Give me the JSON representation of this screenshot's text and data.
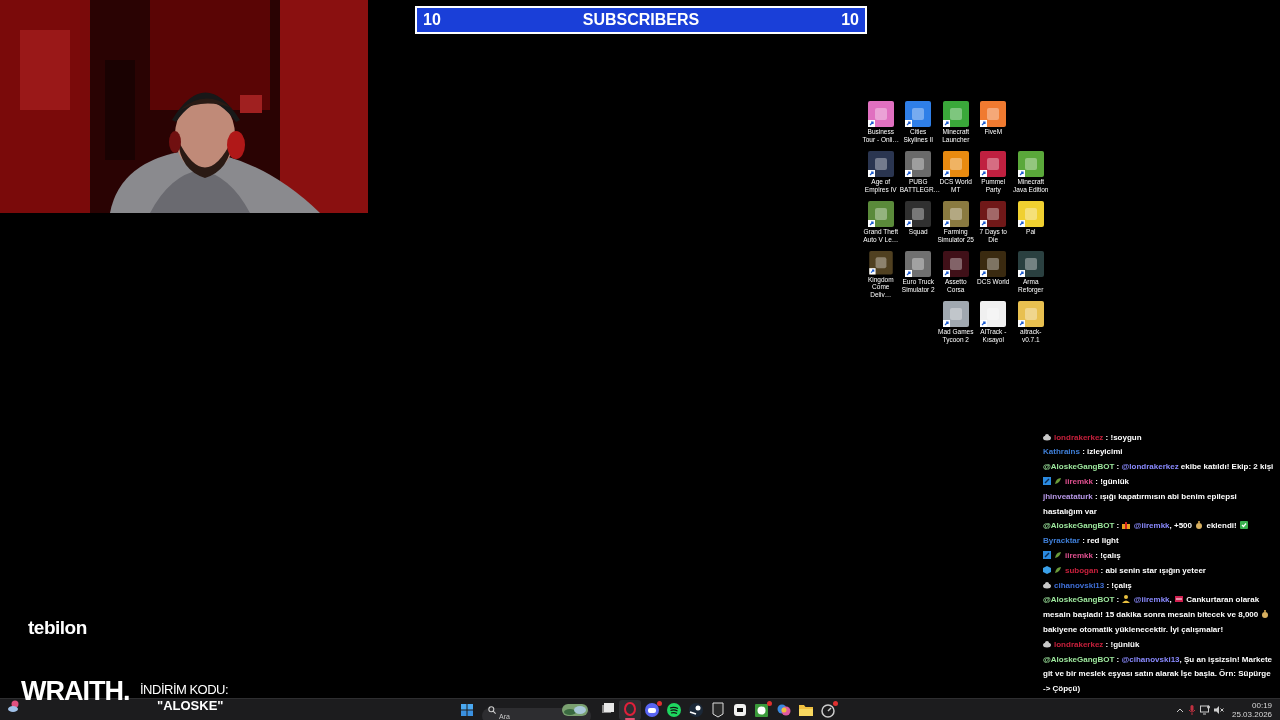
{
  "banner": {
    "left_count": "10",
    "title": "SUBSCRIBERS",
    "right_count": "10"
  },
  "desktop_icon_rows": [
    [
      {
        "label": "Business Tour - Onli…",
        "color": "#e070c0"
      },
      {
        "label": "Cities Skylines II",
        "color": "#2f7fe8"
      },
      {
        "label": "Minecraft Launcher",
        "color": "#3aa83a"
      },
      {
        "label": "FiveM",
        "color": "#f07a30"
      }
    ],
    [
      {
        "label": "Age of Empires IV",
        "color": "#2a3550"
      },
      {
        "label": "PUBG BATTLEGR…",
        "color": "#6a6a6a"
      },
      {
        "label": "DCS World MT",
        "color": "#e88a10"
      },
      {
        "label": "Pummel Party",
        "color": "#c02040"
      },
      {
        "label": "Minecraft Java Edition",
        "color": "#5aa83a"
      }
    ],
    [
      {
        "label": "Grand Theft Auto V Le…",
        "color": "#5a8a3a"
      },
      {
        "label": "Squad",
        "color": "#303030"
      },
      {
        "label": "Farming Simulator 25",
        "color": "#8a7a40"
      },
      {
        "label": "7 Days to Die",
        "color": "#701818"
      },
      {
        "label": "Pal",
        "color": "#f0d030"
      }
    ],
    [
      {
        "label": "Kingdom Come Deliv…",
        "color": "#504020"
      },
      {
        "label": "Euro Truck Simulator 2",
        "color": "#707070"
      },
      {
        "label": "Assetto Corsa",
        "color": "#401018"
      },
      {
        "label": "DCS World",
        "color": "#3a2a10"
      },
      {
        "label": "Arma Reforger",
        "color": "#2a4040"
      }
    ],
    [
      null,
      null,
      {
        "label": "Mad Games Tycoon 2",
        "color": "#a0a8b0"
      },
      {
        "label": "AITrack - Kısayol",
        "color": "#f0f0f0"
      },
      {
        "label": "aitrack-v0.7.1",
        "color": "#e8c050"
      }
    ]
  ],
  "chat": [
    {
      "badges": [
        {
          "kind": "cloud"
        }
      ],
      "user": "londrakerkez",
      "color": "#c8203c",
      "parts": [
        {
          "kind": "text",
          "text": " : !soygun"
        }
      ]
    },
    {
      "user": "Kathrains",
      "color": "#3f7fd8",
      "parts": [
        {
          "kind": "text",
          "text": " : izleyicimi"
        }
      ]
    },
    {
      "user": "@AloskeGangBOT",
      "color": "#9ee89e",
      "parts": [
        {
          "kind": "text",
          "text": " : "
        },
        {
          "kind": "mention",
          "text": "@londrakerkez"
        },
        {
          "kind": "text",
          "text": " ekibe katıldı! Ekip: 2 kişi"
        }
      ]
    },
    {
      "badges": [
        {
          "kind": "square"
        },
        {
          "kind": "leaf"
        }
      ],
      "user": "iiremkk",
      "color": "#e05090",
      "parts": [
        {
          "kind": "text",
          "text": " : !günlük"
        }
      ]
    },
    {
      "user": "jhinveataturk",
      "color": "#b898e8",
      "parts": [
        {
          "kind": "text",
          "text": " : ışığı kapatırmısın abi benim epilepsi hastalığım var"
        }
      ]
    },
    {
      "user": "@AloskeGangBOT",
      "color": "#9ee89e",
      "parts": [
        {
          "kind": "text",
          "text": " : "
        },
        {
          "kind": "gift"
        },
        {
          "kind": "mention",
          "text": " @iiremkk"
        },
        {
          "kind": "text",
          "text": ", +500 "
        },
        {
          "kind": "money"
        },
        {
          "kind": "text",
          "text": " eklendi! "
        },
        {
          "kind": "check"
        }
      ]
    },
    {
      "user": "Byracktar",
      "color": "#3f7fd8",
      "parts": [
        {
          "kind": "text",
          "text": " : red light"
        }
      ]
    },
    {
      "badges": [
        {
          "kind": "square"
        },
        {
          "kind": "leaf"
        }
      ],
      "user": "iiremkk",
      "color": "#e05090",
      "parts": [
        {
          "kind": "text",
          "text": " : !çalış"
        }
      ]
    },
    {
      "badges": [
        {
          "kind": "cube"
        },
        {
          "kind": "leaf"
        }
      ],
      "user": "subogan",
      "color": "#c8203c",
      "parts": [
        {
          "kind": "text",
          "text": " : abi senin star ışığın yeteer"
        }
      ]
    },
    {
      "badges": [
        {
          "kind": "cloud"
        }
      ],
      "user": "cihanovski13",
      "color": "#3f6fd8",
      "parts": [
        {
          "kind": "text",
          "text": " : !çalış"
        }
      ]
    },
    {
      "user": "@AloskeGangBOT",
      "color": "#9ee89e",
      "parts": [
        {
          "kind": "text",
          "text": " : "
        },
        {
          "kind": "figure"
        },
        {
          "kind": "mention",
          "text": " @iiremkk"
        },
        {
          "kind": "text",
          "text": ", "
        },
        {
          "kind": "sign"
        },
        {
          "kind": "text",
          "text": " Cankurtaran olarak mesain başladı! 15 dakika sonra mesain bitecek ve 8,000 "
        },
        {
          "kind": "money"
        },
        {
          "kind": "text",
          "text": " bakiyene otomatik yüklenecektir. İyi çalışmalar!"
        }
      ]
    },
    {
      "badges": [
        {
          "kind": "cloud"
        }
      ],
      "user": "londrakerkez",
      "color": "#c8203c",
      "parts": [
        {
          "kind": "text",
          "text": " : !günlük"
        }
      ]
    },
    {
      "user": "@AloskeGangBOT",
      "color": "#9ee89e",
      "parts": [
        {
          "kind": "text",
          "text": " : "
        },
        {
          "kind": "mention",
          "text": "@cihanovski13"
        },
        {
          "kind": "text",
          "text": ", Şu an işsizsin! Markete git ve bir meslek eşyası satın alarak İşe başla. Örn: Süpürge -> Çöpçü)"
        }
      ]
    }
  ],
  "sponsors": {
    "brand": "tebilon",
    "logo": "WRAITH.",
    "code_label": "İNDİRİM KODU:",
    "code": "\"ALOSKE\""
  },
  "taskbar": {
    "search": {
      "placeholder": "Ara"
    },
    "apps": [
      {
        "kind": "taskview",
        "selected": false,
        "notification": false
      },
      {
        "kind": "ring",
        "selected": true,
        "notification": false
      },
      {
        "kind": "chat",
        "selected": false,
        "notification": true
      },
      {
        "kind": "music",
        "selected": false,
        "notification": false
      },
      {
        "kind": "steam",
        "selected": false,
        "notification": false
      },
      {
        "kind": "epic",
        "selected": false,
        "notification": false
      },
      {
        "kind": "cut",
        "selected": false,
        "notification": false
      },
      {
        "kind": "xbox",
        "selected": false,
        "notification": true
      },
      {
        "kind": "copilot",
        "selected": false,
        "notification": false
      },
      {
        "kind": "folder",
        "selected": false,
        "notification": false
      },
      {
        "kind": "gauge",
        "selected": false,
        "notification": true
      }
    ],
    "clock": {
      "time": "00:19",
      "date": "25.03.2026"
    }
  }
}
